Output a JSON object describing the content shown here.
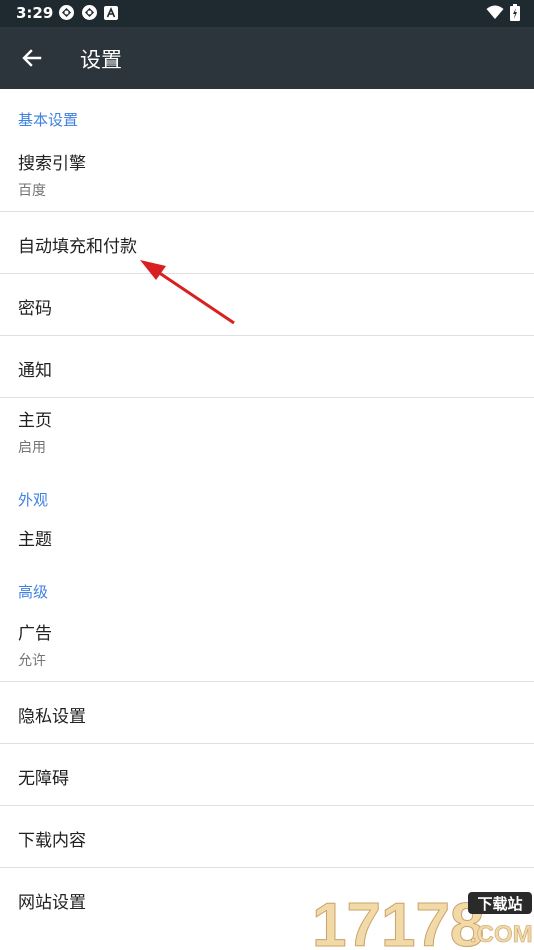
{
  "status_bar": {
    "time": "3:29"
  },
  "app_bar": {
    "title": "设置"
  },
  "sections": {
    "basic": {
      "header": "基本设置",
      "search_engine": {
        "title": "搜索引擎",
        "summary": "百度"
      },
      "autofill": {
        "title": "自动填充和付款"
      },
      "passwords": {
        "title": "密码"
      },
      "notifications": {
        "title": "通知"
      },
      "homepage": {
        "title": "主页",
        "summary": "启用"
      }
    },
    "appearance": {
      "header": "外观",
      "theme": {
        "title": "主题"
      }
    },
    "advanced": {
      "header": "高级",
      "ads": {
        "title": "广告",
        "summary": "允许"
      },
      "privacy": {
        "title": "隐私设置"
      },
      "accessibility": {
        "title": "无障碍"
      },
      "downloads": {
        "title": "下载内容"
      },
      "site_settings": {
        "title": "网站设置"
      }
    }
  },
  "watermark": {
    "text": "17178",
    "badge": "下载站",
    "domain": ".COM"
  },
  "colors": {
    "accent": "#3f82e0",
    "app_bar": "#2b353b",
    "status_bar": "#1f2a30",
    "annotation_arrow": "#d92020"
  },
  "icons": [
    "back-arrow-icon",
    "sync-icon",
    "sync-icon",
    "a-icon",
    "wifi-icon",
    "battery-icon"
  ]
}
